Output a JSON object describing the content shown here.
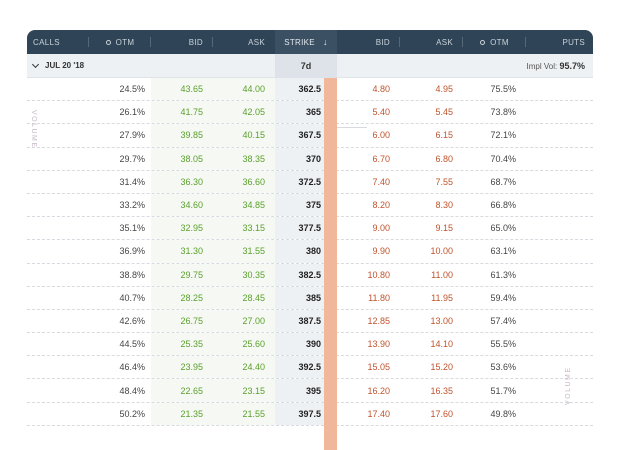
{
  "header": {
    "calls": "CALLS",
    "otm_left": "OTM",
    "bid_left": "BID",
    "ask_left": "ASK",
    "strike": "STRIKE",
    "sort_icon": "down-arrow-icon",
    "bid_right": "BID",
    "ask_right": "ASK",
    "otm_right": "OTM",
    "puts": "PUTS"
  },
  "expiration": {
    "label": "JUL 20 '18",
    "days": "7d",
    "impl_vol_label": "Impl Vol:",
    "impl_vol_value": "95.7%"
  },
  "side_labels": {
    "left": "VOLUME",
    "right": "VOLUME"
  },
  "colors": {
    "header_bg": "#2f4456",
    "call_price": "#5aa02c",
    "put_price": "#c0532d",
    "volume_bar": "#f0b79a"
  },
  "rows": [
    {
      "call_otm": "24.5%",
      "call_bid": "43.65",
      "call_ask": "44.00",
      "strike": "362.5",
      "put_bid": "4.80",
      "put_ask": "4.95",
      "put_otm": "75.5%"
    },
    {
      "call_otm": "26.1%",
      "call_bid": "41.75",
      "call_ask": "42.05",
      "strike": "365",
      "put_bid": "5.40",
      "put_ask": "5.45",
      "put_otm": "73.8%"
    },
    {
      "call_otm": "27.9%",
      "call_bid": "39.85",
      "call_ask": "40.15",
      "strike": "367.5",
      "put_bid": "6.00",
      "put_ask": "6.15",
      "put_otm": "72.1%"
    },
    {
      "call_otm": "29.7%",
      "call_bid": "38.05",
      "call_ask": "38.35",
      "strike": "370",
      "put_bid": "6.70",
      "put_ask": "6.80",
      "put_otm": "70.4%"
    },
    {
      "call_otm": "31.4%",
      "call_bid": "36.30",
      "call_ask": "36.60",
      "strike": "372.5",
      "put_bid": "7.40",
      "put_ask": "7.55",
      "put_otm": "68.7%"
    },
    {
      "call_otm": "33.2%",
      "call_bid": "34.60",
      "call_ask": "34.85",
      "strike": "375",
      "put_bid": "8.20",
      "put_ask": "8.30",
      "put_otm": "66.8%"
    },
    {
      "call_otm": "35.1%",
      "call_bid": "32.95",
      "call_ask": "33.15",
      "strike": "377.5",
      "put_bid": "9.00",
      "put_ask": "9.15",
      "put_otm": "65.0%"
    },
    {
      "call_otm": "36.9%",
      "call_bid": "31.30",
      "call_ask": "31.55",
      "strike": "380",
      "put_bid": "9.90",
      "put_ask": "10.00",
      "put_otm": "63.1%"
    },
    {
      "call_otm": "38.8%",
      "call_bid": "29.75",
      "call_ask": "30.35",
      "strike": "382.5",
      "put_bid": "10.80",
      "put_ask": "11.00",
      "put_otm": "61.3%"
    },
    {
      "call_otm": "40.7%",
      "call_bid": "28.25",
      "call_ask": "28.45",
      "strike": "385",
      "put_bid": "11.80",
      "put_ask": "11.95",
      "put_otm": "59.4%"
    },
    {
      "call_otm": "42.6%",
      "call_bid": "26.75",
      "call_ask": "27.00",
      "strike": "387.5",
      "put_bid": "12.85",
      "put_ask": "13.00",
      "put_otm": "57.4%"
    },
    {
      "call_otm": "44.5%",
      "call_bid": "25.35",
      "call_ask": "25.60",
      "strike": "390",
      "put_bid": "13.90",
      "put_ask": "14.10",
      "put_otm": "55.5%"
    },
    {
      "call_otm": "46.4%",
      "call_bid": "23.95",
      "call_ask": "24.40",
      "strike": "392.5",
      "put_bid": "15.05",
      "put_ask": "15.20",
      "put_otm": "53.6%"
    },
    {
      "call_otm": "48.4%",
      "call_bid": "22.65",
      "call_ask": "23.15",
      "strike": "395",
      "put_bid": "16.20",
      "put_ask": "16.35",
      "put_otm": "51.7%"
    },
    {
      "call_otm": "50.2%",
      "call_bid": "21.35",
      "call_ask": "21.55",
      "strike": "397.5",
      "put_bid": "17.40",
      "put_ask": "17.60",
      "put_otm": "49.8%"
    }
  ]
}
